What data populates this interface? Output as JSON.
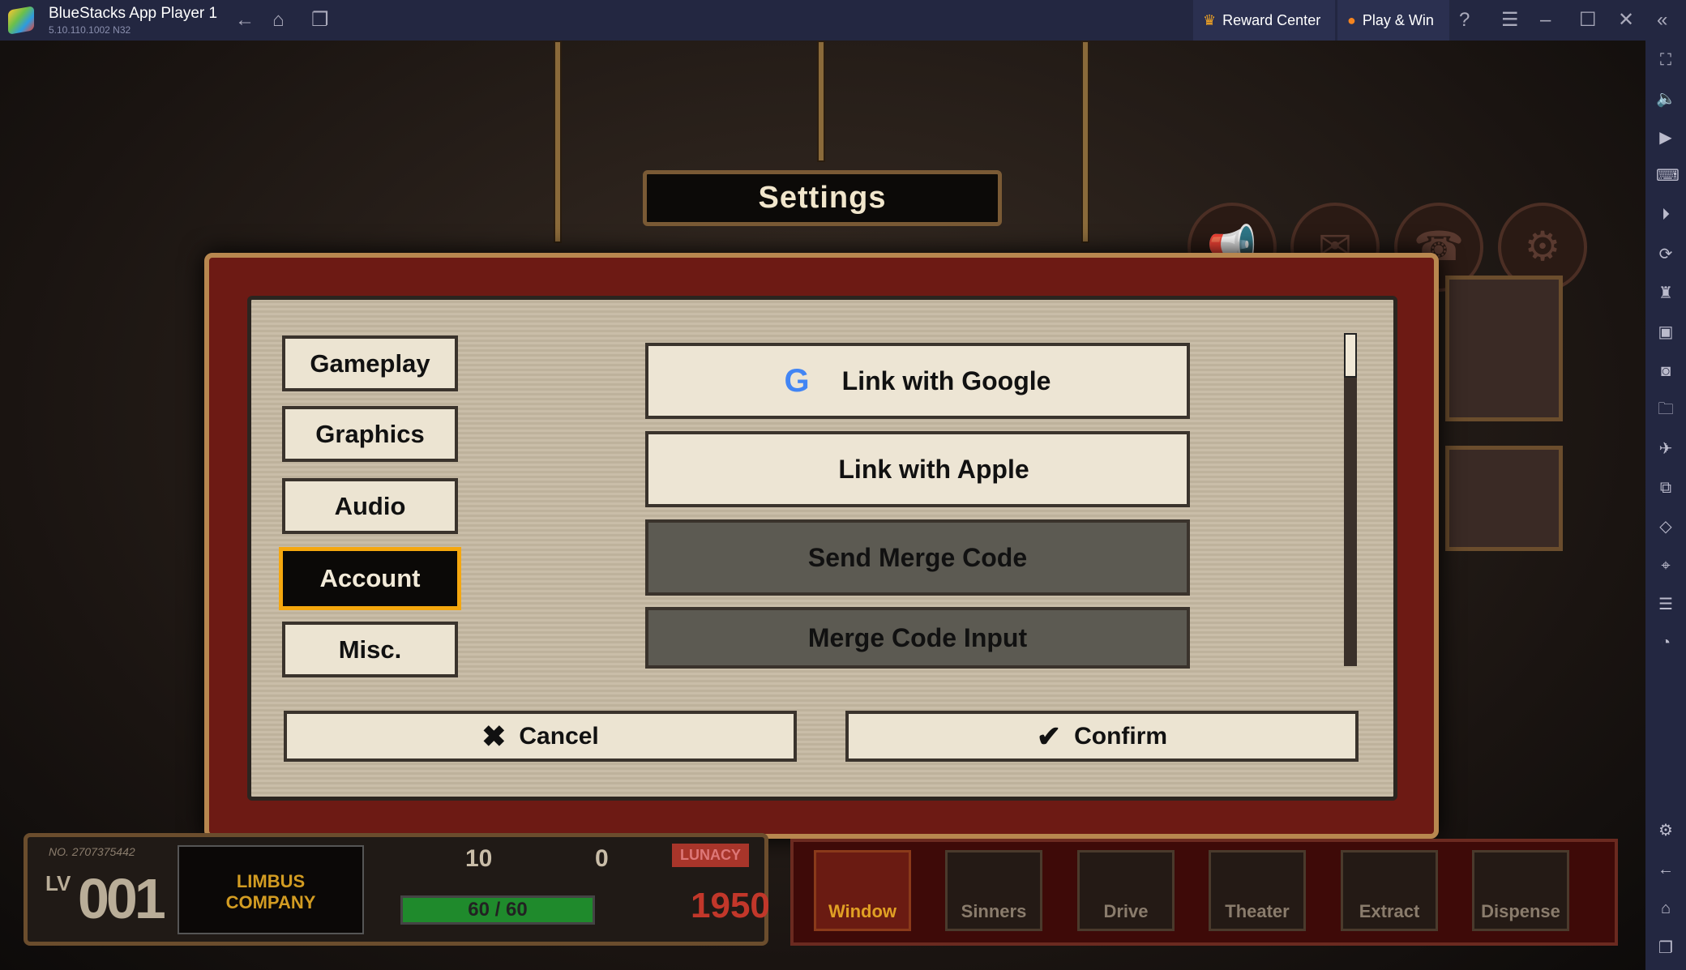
{
  "titlebar": {
    "app_title": "BlueStacks App Player 1",
    "version": "5.10.110.1002  N32",
    "reward_center": "Reward Center",
    "play_win": "Play & Win"
  },
  "settings": {
    "title": "Settings",
    "tabs": [
      {
        "label": "Gameplay"
      },
      {
        "label": "Graphics"
      },
      {
        "label": "Audio"
      },
      {
        "label": "Account",
        "active": true
      },
      {
        "label": "Misc."
      }
    ],
    "options": [
      {
        "label": "Link with Google",
        "icon": "google-icon"
      },
      {
        "label": "Link with Apple",
        "icon": "apple-icon"
      },
      {
        "label": "Send Merge Code"
      },
      {
        "label": "Merge Code Input"
      }
    ],
    "cancel": "Cancel",
    "confirm": "Confirm"
  },
  "hud": {
    "player_no": "NO. 2707375442",
    "lv_label": "LV",
    "level": "001",
    "logo_text": "LIMBUS COMPANY",
    "currency1": "10",
    "currency2": "0",
    "stamina": "60 / 60",
    "lunacy_label": "LUNACY",
    "lunacy": "1950"
  },
  "nav": [
    "Window",
    "Sinners",
    "Drive",
    "Theater",
    "Extract",
    "Dispense"
  ],
  "colors": {
    "accent": "#f5a70e",
    "titlebar": "#232741"
  }
}
